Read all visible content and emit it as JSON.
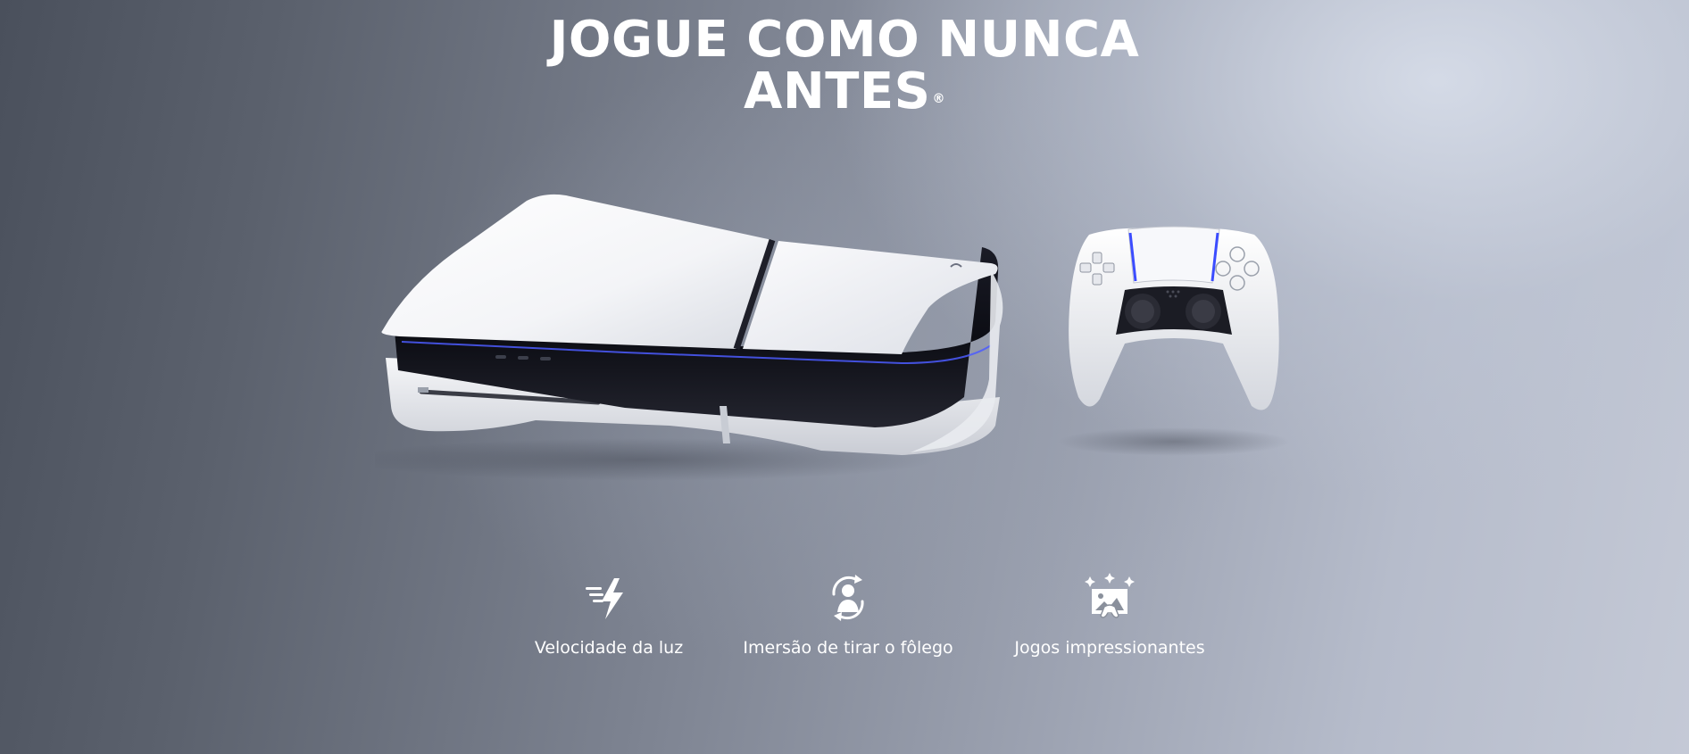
{
  "hero": {
    "headline_line1": "JOGUE COMO NUNCA",
    "headline_line2": "ANTES",
    "headline_mark": "®"
  },
  "product": {
    "items": [
      "ps5-slim-console",
      "dualsense-controller"
    ],
    "accent_color": "#3b4cff"
  },
  "features": [
    {
      "icon": "lightning-speed-icon",
      "label": "Velocidade da luz"
    },
    {
      "icon": "immersion-person-icon",
      "label": "Imersão de tirar o fôlego"
    },
    {
      "icon": "sparkle-gallery-controller-icon",
      "label": "Jogos impressionantes"
    }
  ]
}
